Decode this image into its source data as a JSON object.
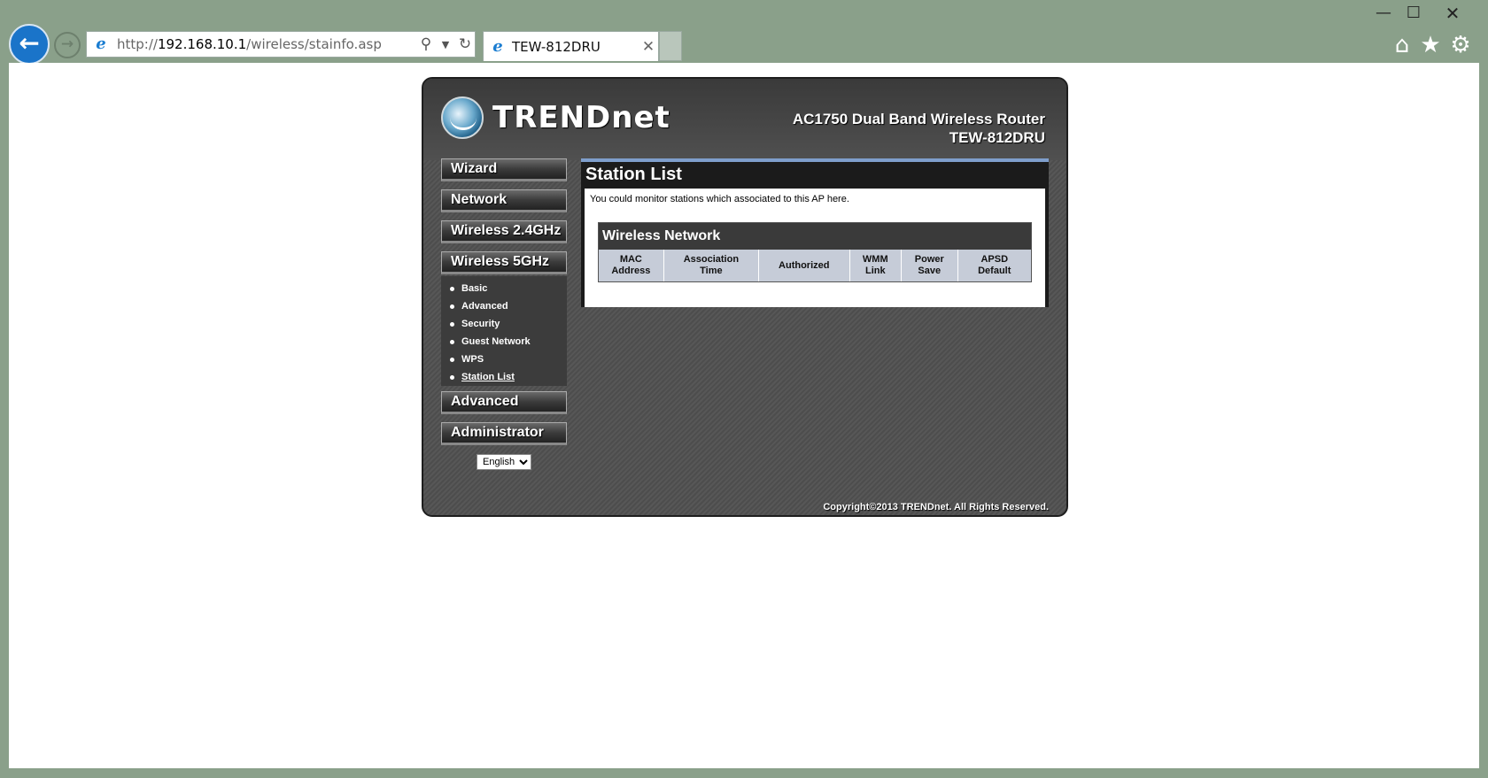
{
  "window": {
    "min": "—",
    "max": "☐",
    "close": "✕"
  },
  "browser": {
    "url_prefix": "http://",
    "url_host": "192.168.10.1",
    "url_path": "/wireless/stainfo.asp",
    "tab_title": "TEW-812DRU",
    "icons": {
      "back": "arrow-left-icon",
      "forward": "arrow-right-icon",
      "search": "search-icon",
      "refresh": "refresh-icon",
      "home": "home-icon",
      "favorites": "star-icon",
      "settings": "gear-icon"
    }
  },
  "router": {
    "brand": "TRENDnet",
    "product": "AC1750 Dual Band Wireless Router",
    "model": "TEW-812DRU",
    "nav": {
      "wizard": "Wizard",
      "network": "Network",
      "wireless24": "Wireless 2.4GHz",
      "wireless5": "Wireless 5GHz",
      "advanced": "Advanced",
      "administrator": "Administrator"
    },
    "submenu": [
      {
        "label": "Basic"
      },
      {
        "label": "Advanced"
      },
      {
        "label": "Security"
      },
      {
        "label": "Guest Network"
      },
      {
        "label": "WPS"
      },
      {
        "label": "Station List"
      }
    ],
    "language": "English",
    "content": {
      "title": "Station List",
      "intro": "You could monitor stations which associated to this AP here.",
      "section_title": "Wireless Network",
      "columns": [
        {
          "line1": "MAC",
          "line2": "Address"
        },
        {
          "line1": "Association",
          "line2": "Time"
        },
        {
          "line1": "Authorized",
          "line2": ""
        },
        {
          "line1": "WMM",
          "line2": "Link"
        },
        {
          "line1": "Power",
          "line2": "Save"
        },
        {
          "line1": "APSD",
          "line2": "Default"
        }
      ]
    },
    "copyright": "Copyright©2013 TRENDnet. All Rights Reserved."
  },
  "colors": {
    "accent": "#7f9fcc",
    "browser_frame": "#8aa08a",
    "back_button": "#1a74c9"
  }
}
